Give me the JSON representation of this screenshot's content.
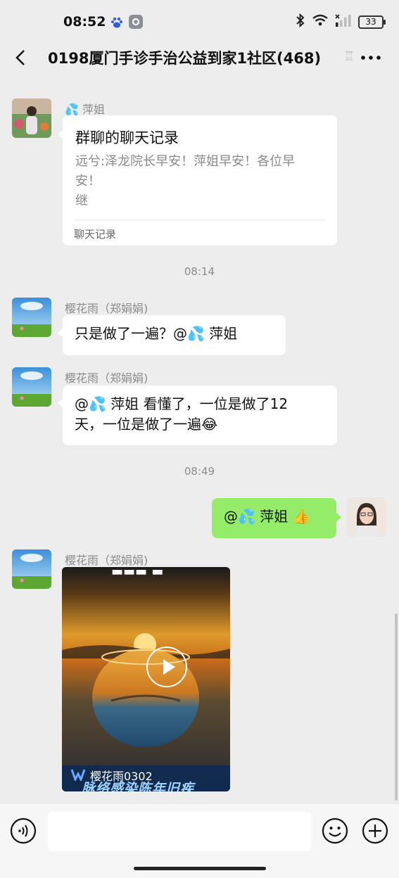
{
  "status_bar": {
    "time": "08:52",
    "battery": "33"
  },
  "nav": {
    "title": "0198厦门手诊手治公益到家1社区(468)",
    "title_extra": "♖"
  },
  "messages": {
    "m1": {
      "sender": "💦 萍姐",
      "record_title": "群聊的聊天记录",
      "record_lines": [
        "远兮:泽龙院长早安！萍姐早安！各位早",
        "安！",
        "继"
      ],
      "record_footer": "聊天记录"
    },
    "time1": "08:14",
    "m2": {
      "sender": "樱花雨（郑娟娟)",
      "text": "只是做了一遍？@💦 萍姐"
    },
    "m3": {
      "sender": "樱花雨（郑娟娟)",
      "line1": "@💦 萍姐  看懂了，一位是做了12",
      "line2": "天，一位是做了一遍😂"
    },
    "time2": "08:49",
    "m4": {
      "text": "@💦 萍姐 👍"
    },
    "m5": {
      "sender": "樱花雨（郑娟娟)",
      "video_author": "樱花雨0302",
      "video_caption": "脉络感染陈年旧疾"
    }
  },
  "colors": {
    "accent_green": "#95ec69",
    "chat_bg": "#ededed"
  },
  "icons": [
    "back-arrow-icon",
    "more-icon",
    "voice-icon",
    "emoji-icon",
    "plus-icon",
    "play-icon"
  ]
}
